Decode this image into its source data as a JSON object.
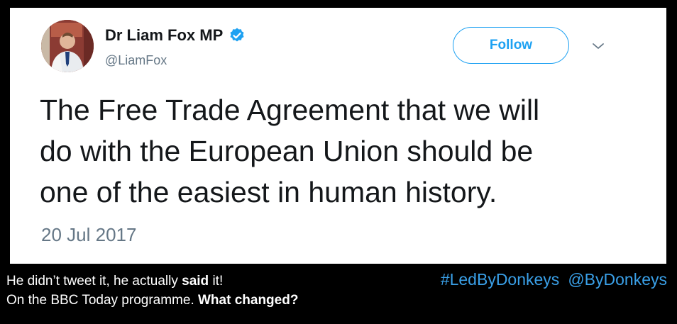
{
  "tweet": {
    "display_name": "Dr Liam Fox MP",
    "handle": "@LiamFox",
    "follow_label": "Follow",
    "text_lines": [
      "The Free Trade Agreement that we will",
      "do with the European Union should be",
      "one of the easiest in human history."
    ],
    "date": "20 Jul 2017",
    "avatar_icon": "profile-photo",
    "verified_icon": "verified-badge-icon",
    "menu_icon": "chevron-down-icon",
    "accent_color": "#1da1f2"
  },
  "caption": {
    "line1_a": "He didn’t tweet it, he actually ",
    "line1_bold": "said",
    "line1_b": " it!",
    "line2_a": "On the BBC Today programme. ",
    "line2_bold": "What changed?"
  },
  "tags": {
    "hashtag": "#LedByDonkeys",
    "mention": "@ByDonkeys",
    "color": "#3aa0e8"
  }
}
